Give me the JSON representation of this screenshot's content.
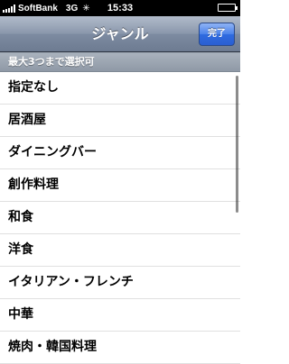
{
  "status_bar": {
    "carrier": "SoftBank",
    "network": "3G",
    "activity": "✳",
    "time": "15:33",
    "battery_level": 1.0
  },
  "nav": {
    "title": "ジャンル",
    "done_label": "完了"
  },
  "section": {
    "header": "最大3つまで選択可"
  },
  "items": [
    {
      "label": "指定なし"
    },
    {
      "label": "居酒屋"
    },
    {
      "label": "ダイニングバー"
    },
    {
      "label": "創作料理"
    },
    {
      "label": "和食"
    },
    {
      "label": "洋食"
    },
    {
      "label": "イタリアン・フレンチ"
    },
    {
      "label": "中華"
    },
    {
      "label": "焼肉・韓国料理"
    }
  ],
  "colors": {
    "nav_top": "#b2bccb",
    "nav_bottom": "#6d7b91",
    "done_button": "#2f6be0",
    "section_header": "#8f99a6"
  }
}
